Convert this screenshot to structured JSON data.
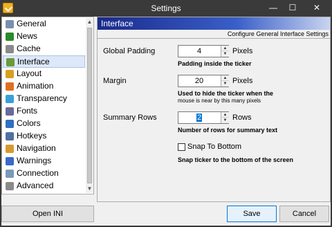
{
  "window": {
    "title": "Settings",
    "min_glyph": "—",
    "max_glyph": "☐",
    "close_glyph": "✕"
  },
  "sidebar": {
    "items": [
      {
        "label": "General",
        "icon": "general-icon",
        "color": "#7a8fb0"
      },
      {
        "label": "News",
        "icon": "news-arrow-icon",
        "color": "#2a8a2a"
      },
      {
        "label": "Cache",
        "icon": "cache-icon",
        "color": "#8a8a8a"
      },
      {
        "label": "Interface",
        "icon": "interface-icon",
        "color": "#6a9a3a",
        "selected": true
      },
      {
        "label": "Layout",
        "icon": "layout-icon",
        "color": "#d8a020"
      },
      {
        "label": "Animation",
        "icon": "animation-icon",
        "color": "#e07020"
      },
      {
        "label": "Transparency",
        "icon": "transparency-icon",
        "color": "#3aa0d8"
      },
      {
        "label": "Fonts",
        "icon": "fonts-icon",
        "color": "#6a6a9a"
      },
      {
        "label": "Colors",
        "icon": "colors-icon",
        "color": "#3070c0"
      },
      {
        "label": "Hotkeys",
        "icon": "hotkeys-icon",
        "color": "#5070a0"
      },
      {
        "label": "Navigation",
        "icon": "navigation-icon",
        "color": "#d89a30"
      },
      {
        "label": "Warnings",
        "icon": "warnings-icon",
        "color": "#3a6ac8"
      },
      {
        "label": "Connection",
        "icon": "connection-icon",
        "color": "#7a9aba"
      },
      {
        "label": "Advanced",
        "icon": "advanced-icon",
        "color": "#8a8a8a"
      }
    ],
    "scroll_up_glyph": "▲",
    "scroll_down_glyph": "▼"
  },
  "buttons": {
    "open_ini": "Open INI",
    "save": "Save",
    "cancel": "Cancel"
  },
  "panel": {
    "title": "Interface",
    "subtitle": "Configure General Interface Settings",
    "global_padding": {
      "label": "Global Padding",
      "value": "4",
      "unit": "Pixels",
      "hint": "Padding inside the ticker"
    },
    "margin": {
      "label": "Margin",
      "value": "20",
      "unit": "Pixels",
      "hint": "Used to hide the ticker when the",
      "hint2": "mouse is near by this many pixels"
    },
    "summary_rows": {
      "label": "Summary Rows",
      "value": "2",
      "unit": "Rows",
      "hint": "Number of rows for summary text"
    },
    "snap": {
      "label": "Snap To Bottom",
      "checked": false,
      "hint": "Snap ticker to the bottom of the screen"
    },
    "spin_up_glyph": "▲",
    "spin_down_glyph": "▼"
  }
}
